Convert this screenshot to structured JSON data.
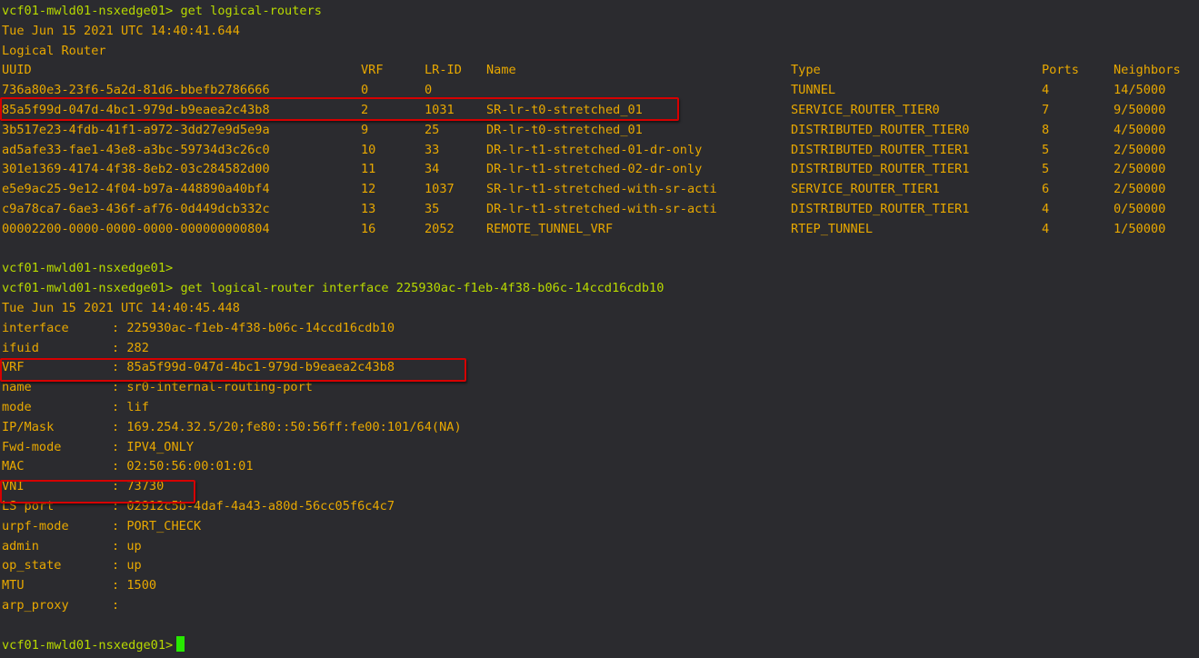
{
  "session": {
    "prompt": "vcf01-mwld01-nsxedge01>",
    "cmd1": "get logical-routers",
    "timestamp1": "Tue Jun 15 2021 UTC 14:40:41.644",
    "section_title": "Logical Router",
    "cmd2": "get logical-router interface 225930ac-f1eb-4f38-b06c-14ccd16cdb10",
    "timestamp2": "Tue Jun 15 2021 UTC 14:40:45.448"
  },
  "routers_table": {
    "headers": [
      "UUID",
      "VRF",
      "LR-ID",
      "Name",
      "Type",
      "Ports",
      "Neighbors"
    ],
    "rows": [
      [
        "736a80e3-23f6-5a2d-81d6-bbefb2786666",
        "0",
        "0",
        "",
        "TUNNEL",
        "4",
        "14/5000"
      ],
      [
        "85a5f99d-047d-4bc1-979d-b9eaea2c43b8",
        "2",
        "1031",
        "SR-lr-t0-stretched_01",
        "SERVICE_ROUTER_TIER0",
        "7",
        "9/50000"
      ],
      [
        "3b517e23-4fdb-41f1-a972-3dd27e9d5e9a",
        "9",
        "25",
        "DR-lr-t0-stretched_01",
        "DISTRIBUTED_ROUTER_TIER0",
        "8",
        "4/50000"
      ],
      [
        "ad5afe33-fae1-43e8-a3bc-59734d3c26c0",
        "10",
        "33",
        "DR-lr-t1-stretched-01-dr-only",
        "DISTRIBUTED_ROUTER_TIER1",
        "5",
        "2/50000"
      ],
      [
        "301e1369-4174-4f38-8eb2-03c284582d00",
        "11",
        "34",
        "DR-lr-t1-stretched-02-dr-only",
        "DISTRIBUTED_ROUTER_TIER1",
        "5",
        "2/50000"
      ],
      [
        "e5e9ac25-9e12-4f04-b97a-448890a40bf4",
        "12",
        "1037",
        "SR-lr-t1-stretched-with-sr-acti",
        "SERVICE_ROUTER_TIER1",
        "6",
        "2/50000"
      ],
      [
        "c9a78ca7-6ae3-436f-af76-0d449dcb332c",
        "13",
        "35",
        "DR-lr-t1-stretched-with-sr-acti",
        "DISTRIBUTED_ROUTER_TIER1",
        "4",
        "0/50000"
      ],
      [
        "00002200-0000-0000-0000-000000000804",
        "16",
        "2052",
        "REMOTE_TUNNEL_VRF",
        "RTEP_TUNNEL",
        "4",
        "1/50000"
      ]
    ]
  },
  "interface": [
    {
      "key": "interface",
      "value": ": 225930ac-f1eb-4f38-b06c-14ccd16cdb10"
    },
    {
      "key": "ifuid",
      "value": ": 282"
    },
    {
      "key": "VRF",
      "value": ": 85a5f99d-047d-4bc1-979d-b9eaea2c43b8"
    },
    {
      "key": "name",
      "value": ": sr0-internal-routing-port"
    },
    {
      "key": "mode",
      "value": ": lif"
    },
    {
      "key": "IP/Mask",
      "value": ": 169.254.32.5/20;fe80::50:56ff:fe00:101/64(NA)"
    },
    {
      "key": "Fwd-mode",
      "value": ": IPV4_ONLY"
    },
    {
      "key": "MAC",
      "value": ": 02:50:56:00:01:01"
    },
    {
      "key": "VNI",
      "value": ": 73730"
    },
    {
      "key": "LS port",
      "value": ": 02912c5b-4daf-4a43-a80d-56cc05f6c4c7"
    },
    {
      "key": "urpf-mode",
      "value": ": PORT_CHECK"
    },
    {
      "key": "admin",
      "value": ": up"
    },
    {
      "key": "op_state",
      "value": ": up"
    },
    {
      "key": "MTU",
      "value": ": 1500"
    },
    {
      "key": "arp_proxy",
      "value": ":"
    }
  ],
  "colors": {
    "background": "#2b2b2f",
    "prompt": "#b8d900",
    "output": "#e8a800",
    "highlight_box": "#d60000",
    "cursor": "#27e800"
  }
}
